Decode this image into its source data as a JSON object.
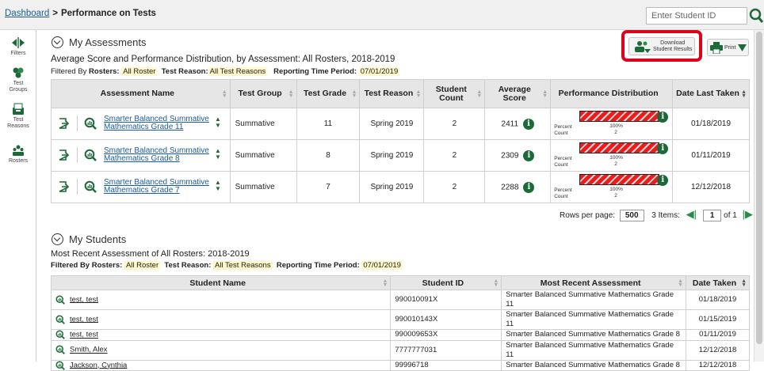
{
  "breadcrumb": {
    "home": "Dashboard",
    "separator": ">",
    "current": "Performance on Tests"
  },
  "search": {
    "placeholder": "Enter Student ID"
  },
  "rail": {
    "filters": "Filters",
    "test_groups_1": "Test",
    "test_groups_2": "Groups",
    "test_reasons_1": "Test",
    "test_reasons_2": "Reasons",
    "rosters": "Rosters"
  },
  "assessments": {
    "heading": "My Assessments",
    "subtitle": "Average Score and Performance Distribution, by Assessment: All Rosters, 2018-2019",
    "filtered_by": "Filtered By",
    "rosters_label": "Rosters:",
    "rosters_value": "All Roster",
    "reason_label": "Test Reason:",
    "reason_value": "All Test Reasons",
    "period_label": "Reporting Time Period:",
    "period_value": "07/01/2019",
    "download_line1": "Download",
    "download_line2": "Student Results",
    "print_label": "Print",
    "columns": [
      "Assessment Name",
      "Test Group",
      "Test Grade",
      "Test Reason",
      "Student Count",
      "Average Score",
      "Performance Distribution",
      "Date Last Taken"
    ],
    "rows": [
      {
        "name1": "Smarter Balanced Summative",
        "name2": "Mathematics Grade 11",
        "group": "Summative",
        "grade": "11",
        "reason": "Spring 2019",
        "count": "2",
        "score": "2411",
        "pct_label": "Percent",
        "pct": "100%",
        "cnt_label": "Count",
        "cnt": "2",
        "date": "01/18/2019"
      },
      {
        "name1": "Smarter Balanced Summative",
        "name2": "Mathematics Grade 8",
        "group": "Summative",
        "grade": "8",
        "reason": "Spring 2019",
        "count": "2",
        "score": "2309",
        "pct_label": "Percent",
        "pct": "100%",
        "cnt_label": "Count",
        "cnt": "2",
        "date": "01/11/2019"
      },
      {
        "name1": "Smarter Balanced Summative",
        "name2": "Mathematics Grade 7",
        "group": "Summative",
        "grade": "7",
        "reason": "Spring 2019",
        "count": "2",
        "score": "2288",
        "pct_label": "Percent",
        "pct": "100%",
        "cnt_label": "Count",
        "cnt": "2",
        "date": "12/12/2018"
      }
    ],
    "pager": {
      "rows_per_page_label": "Rows per page:",
      "rows_per_page": "500",
      "items": "3 Items:",
      "page": "1",
      "of": "of 1"
    }
  },
  "students": {
    "heading": "My Students",
    "subtitle": "Most Recent Assessment of All Rosters: 2018-2019",
    "filtered_by": "Filtered By",
    "rosters_label": "Rosters:",
    "rosters_value": "All Roster",
    "reason_label": "Test Reason:",
    "reason_value": "All Test Reasons",
    "period_label": "Reporting Time Period:",
    "period_value": "07/01/2019",
    "columns": [
      "Student Name",
      "Student ID",
      "Most Recent Assessment",
      "Date Taken"
    ],
    "rows": [
      {
        "name": "test, test",
        "id": "990010091X",
        "assessment": "Smarter Balanced Summative Mathematics Grade 11",
        "date": "01/18/2019"
      },
      {
        "name": "test, test",
        "id": "990010143X",
        "assessment": "Smarter Balanced Summative Mathematics Grade 11",
        "date": "01/15/2019"
      },
      {
        "name": "test, test",
        "id": "990009653X",
        "assessment": "Smarter Balanced Summative Mathematics Grade 8",
        "date": "01/11/2019"
      },
      {
        "name": "Smith, Alex",
        "id": "7777777031",
        "assessment": "Smarter Balanced Summative Mathematics Grade 11",
        "date": "12/12/2018"
      },
      {
        "name": "Jackson, Cynthia",
        "id": "99996718",
        "assessment": "Smarter Balanced Summative Mathematics Grade 8",
        "date": "12/12/2018"
      }
    ]
  },
  "colors": {
    "accent": "#1a5b9c",
    "highlight": "#e0001b",
    "info_green": "#1c6a3a",
    "bar_red": "#ea1c1c"
  }
}
